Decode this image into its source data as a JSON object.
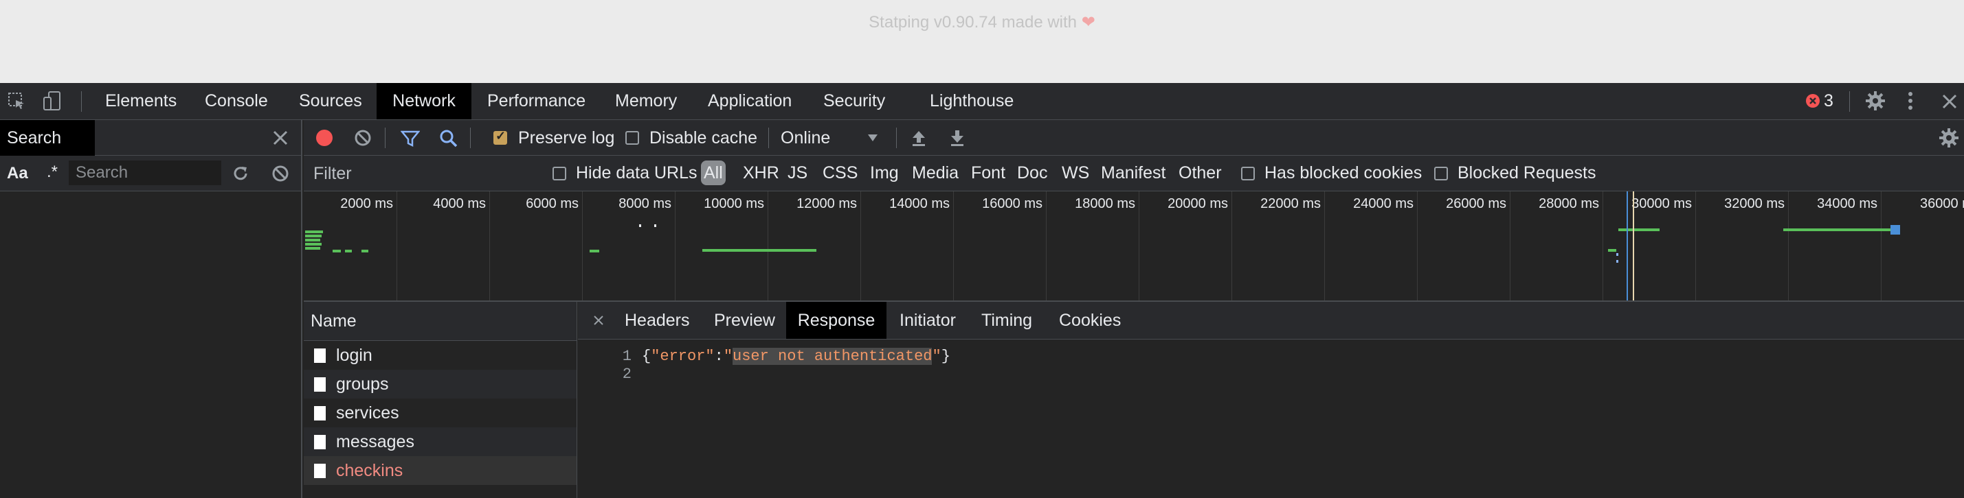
{
  "page": {
    "footer_text": "Statping v0.90.74 made with",
    "heart": "❤"
  },
  "devtools": {
    "tabs": [
      "Elements",
      "Console",
      "Sources",
      "Network",
      "Performance",
      "Memory",
      "Application",
      "Security",
      "Lighthouse"
    ],
    "active_tab": "Network",
    "error_count": "3"
  },
  "search_panel": {
    "title": "Search",
    "match_case": "Aa",
    "regex": ".*",
    "placeholder": "Search"
  },
  "network_toolbar": {
    "preserve_log": {
      "label": "Preserve log",
      "checked": true
    },
    "disable_cache": {
      "label": "Disable cache",
      "checked": false
    },
    "throttle_value": "Online"
  },
  "filter_bar": {
    "placeholder": "Filter",
    "hide_data_urls": "Hide data URLs",
    "types": [
      "All",
      "XHR",
      "JS",
      "CSS",
      "Img",
      "Media",
      "Font",
      "Doc",
      "WS",
      "Manifest",
      "Other"
    ],
    "has_blocked_cookies": "Has blocked cookies",
    "blocked_requests": "Blocked Requests"
  },
  "timeline": {
    "ticks": [
      "2000 ms",
      "4000 ms",
      "6000 ms",
      "8000 ms",
      "10000 ms",
      "12000 ms",
      "14000 ms",
      "16000 ms",
      "18000 ms",
      "20000 ms",
      "22000 ms",
      "24000 ms",
      "26000 ms",
      "28000 ms",
      "30000 ms",
      "32000 ms",
      "34000 ms",
      "36000 m"
    ]
  },
  "requests": {
    "header": "Name",
    "items": [
      "login",
      "groups",
      "services",
      "messages",
      "checkins"
    ],
    "selected": "checkins"
  },
  "details": {
    "tabs": [
      "Headers",
      "Preview",
      "Response",
      "Initiator",
      "Timing",
      "Cookies"
    ],
    "active_tab": "Response",
    "line_numbers": [
      "1",
      "2"
    ],
    "response": {
      "open": "{",
      "key": "\"error\"",
      "colon": ":",
      "quote_open": "\"",
      "value": "user not authenticated",
      "quote_close": "\"",
      "close": "}"
    }
  },
  "colors": {
    "accent_blue": "#8ab4f8",
    "record_red": "#f55454",
    "error_red": "#f28b82",
    "timeline_green": "#5ac05a",
    "string_orange": "#f29766"
  }
}
